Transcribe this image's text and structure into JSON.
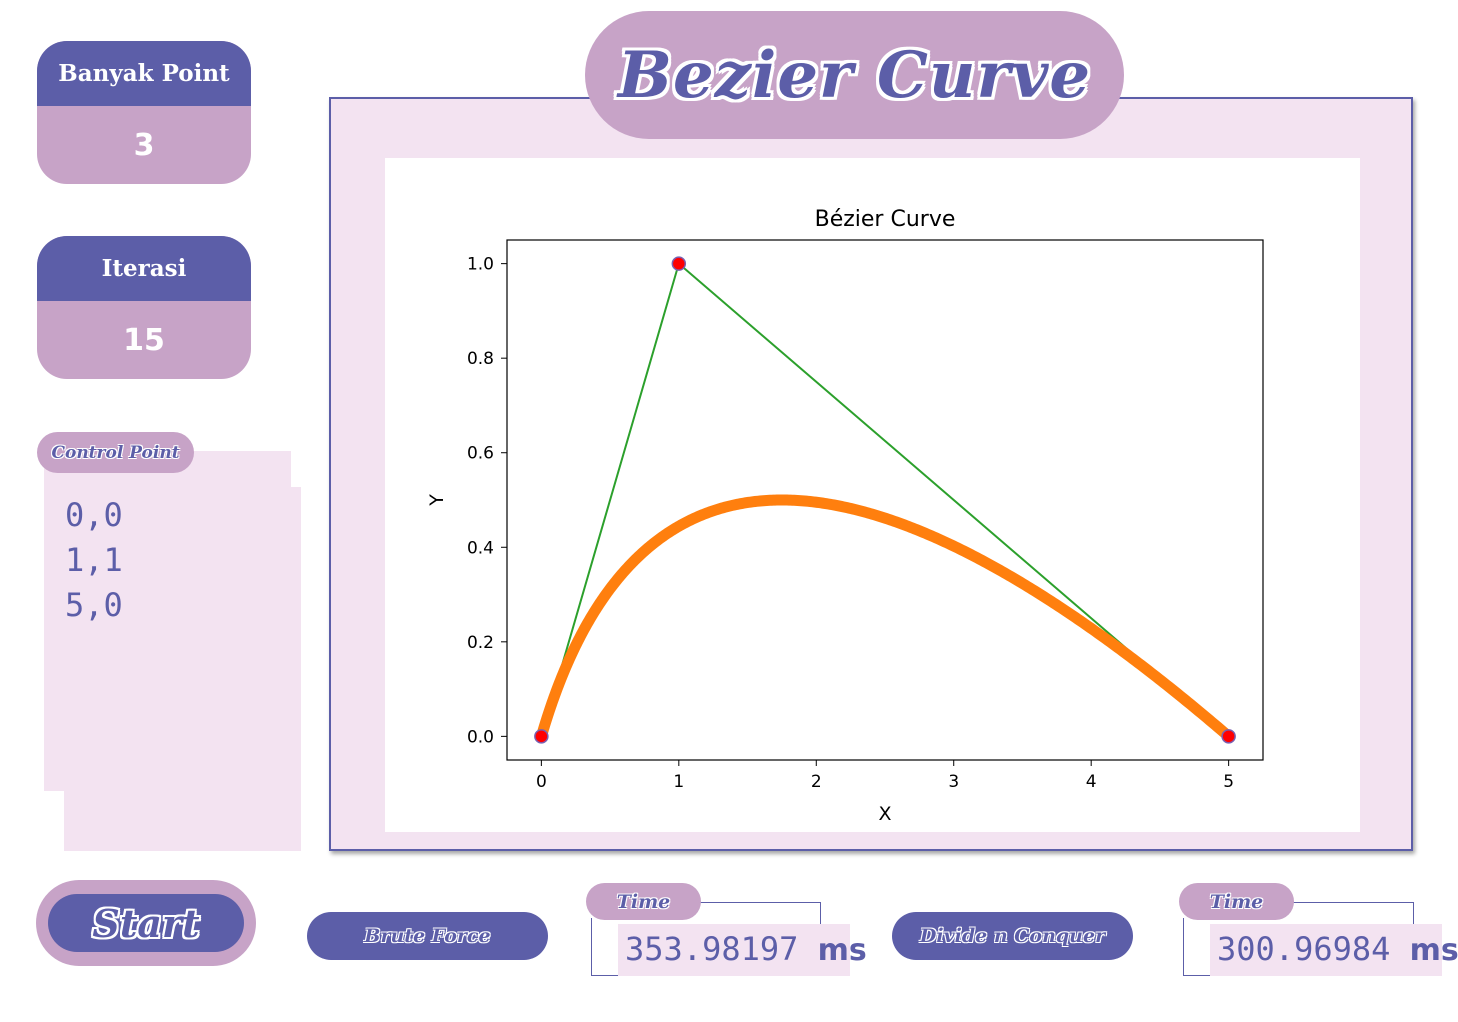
{
  "left_panel": {
    "points_card": {
      "label": "Banyak Point",
      "value": "3"
    },
    "iteration_card": {
      "label": "Iterasi",
      "value": "15"
    },
    "control_points": {
      "label": "Control Point",
      "items": [
        "0,0",
        "1,1",
        "5,0"
      ]
    }
  },
  "header": {
    "title": "Bezier Curve"
  },
  "controls": {
    "start_label": "Start",
    "brute_force": {
      "label": "Brute Force",
      "time_label": "Time",
      "time_value": "353.98197",
      "time_unit": "ms"
    },
    "divide_conquer": {
      "label": "Divide n Conquer",
      "time_label": "Time",
      "time_value": "300.96984",
      "time_unit": "ms"
    }
  },
  "colors": {
    "primary": "#5c5ea8",
    "accent": "#c7a3c7",
    "panel_bg": "#f3e3f1",
    "curve": "#ff7f0e",
    "control_polygon": "#2ca02c",
    "control_point": "#ff0000"
  },
  "chart_data": {
    "type": "line",
    "title": "Bézier Curve",
    "xlabel": "X",
    "ylabel": "Y",
    "xlim": [
      -0.25,
      5.25
    ],
    "ylim": [
      -0.05,
      1.05
    ],
    "x_ticks": [
      0,
      1,
      2,
      3,
      4,
      5
    ],
    "x_tick_labels": [
      "0",
      "1",
      "2",
      "3",
      "4",
      "5"
    ],
    "y_ticks": [
      0.0,
      0.2,
      0.4,
      0.6,
      0.8,
      1.0
    ],
    "y_tick_labels": [
      "0.0",
      "0.2",
      "0.4",
      "0.6",
      "0.8",
      "1.0"
    ],
    "control_points": [
      [
        0,
        0
      ],
      [
        1,
        1
      ],
      [
        5,
        0
      ]
    ],
    "curve_samples": 16385,
    "grid": false
  }
}
